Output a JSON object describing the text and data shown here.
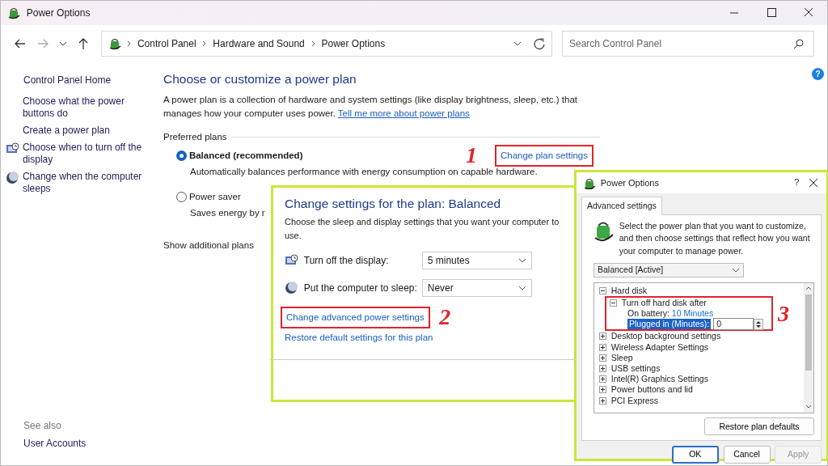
{
  "window": {
    "title": "Power Options"
  },
  "address_bar": {
    "crumbs": [
      "Control Panel",
      "Hardware and Sound",
      "Power Options"
    ]
  },
  "search": {
    "placeholder": "Search Control Panel"
  },
  "help": "?",
  "sidebar": {
    "home": "Control Panel Home",
    "links": [
      {
        "label": "Choose what the power buttons do",
        "kind": "plain"
      },
      {
        "label": "Create a power plan",
        "kind": "plain"
      },
      {
        "label": "Choose when to turn off the display",
        "kind": "monitor"
      },
      {
        "label": "Change when the computer sleeps",
        "kind": "moon"
      }
    ],
    "see_also": "See also",
    "see_also_links": [
      "User Accounts"
    ]
  },
  "main": {
    "title": "Choose or customize a power plan",
    "intro": "A power plan is a collection of hardware and system settings (like display brightness, sleep, etc.) that manages how your computer uses power.",
    "intro_link": "Tell me more about power plans",
    "group_label": "Preferred plans",
    "plans": [
      {
        "name": "Balanced (recommended)",
        "description": "Automatically balances performance with energy consumption on capable hardware.",
        "selected": true,
        "action": "Change plan settings"
      },
      {
        "name": "Power saver",
        "description": "Saves energy by r",
        "selected": false
      }
    ],
    "show_more": "Show additional plans"
  },
  "plan_panel": {
    "title": "Change settings for the plan: Balanced",
    "subtitle": "Choose the sleep and display settings that you want your computer to use.",
    "settings": [
      {
        "label": "Turn off the display:",
        "value": "5 minutes",
        "kind": "monitor"
      },
      {
        "label": "Put the computer to sleep:",
        "value": "Never",
        "kind": "moon"
      }
    ],
    "links": [
      "Change advanced power settings",
      "Restore default settings for this plan"
    ]
  },
  "dialog": {
    "title": "Power Options",
    "help": "?",
    "tab": "Advanced settings",
    "intro": "Select the power plan that you want to customize, and then choose settings that reflect how you want your computer to manage power.",
    "plan": "Balanced [Active]",
    "tree": [
      {
        "label": "Hard disk",
        "expanded": true,
        "children": [
          {
            "label": "Turn off hard disk after",
            "expanded": true,
            "children": [
              {
                "kind": "value",
                "label": "On battery:",
                "value": "10 Minutes",
                "selected": false
              },
              {
                "kind": "spinner",
                "label": "Plugged in (Minutes):",
                "value": "0",
                "selected": true
              }
            ]
          }
        ]
      },
      {
        "label": "Desktop background settings",
        "expanded": false
      },
      {
        "label": "Wireless Adapter Settings",
        "expanded": false
      },
      {
        "label": "Sleep",
        "expanded": false
      },
      {
        "label": "USB settings",
        "expanded": false
      },
      {
        "label": "Intel(R) Graphics Settings",
        "expanded": false
      },
      {
        "label": "Power buttons and lid",
        "expanded": false
      },
      {
        "label": "PCI Express",
        "expanded": false
      }
    ],
    "restore": "Restore plan defaults",
    "buttons": [
      {
        "label": "OK",
        "default": true,
        "disabled": false
      },
      {
        "label": "Cancel",
        "default": false,
        "disabled": false
      },
      {
        "label": "Apply",
        "default": false,
        "disabled": true
      }
    ]
  },
  "annotations": [
    "1",
    "2",
    "3"
  ]
}
